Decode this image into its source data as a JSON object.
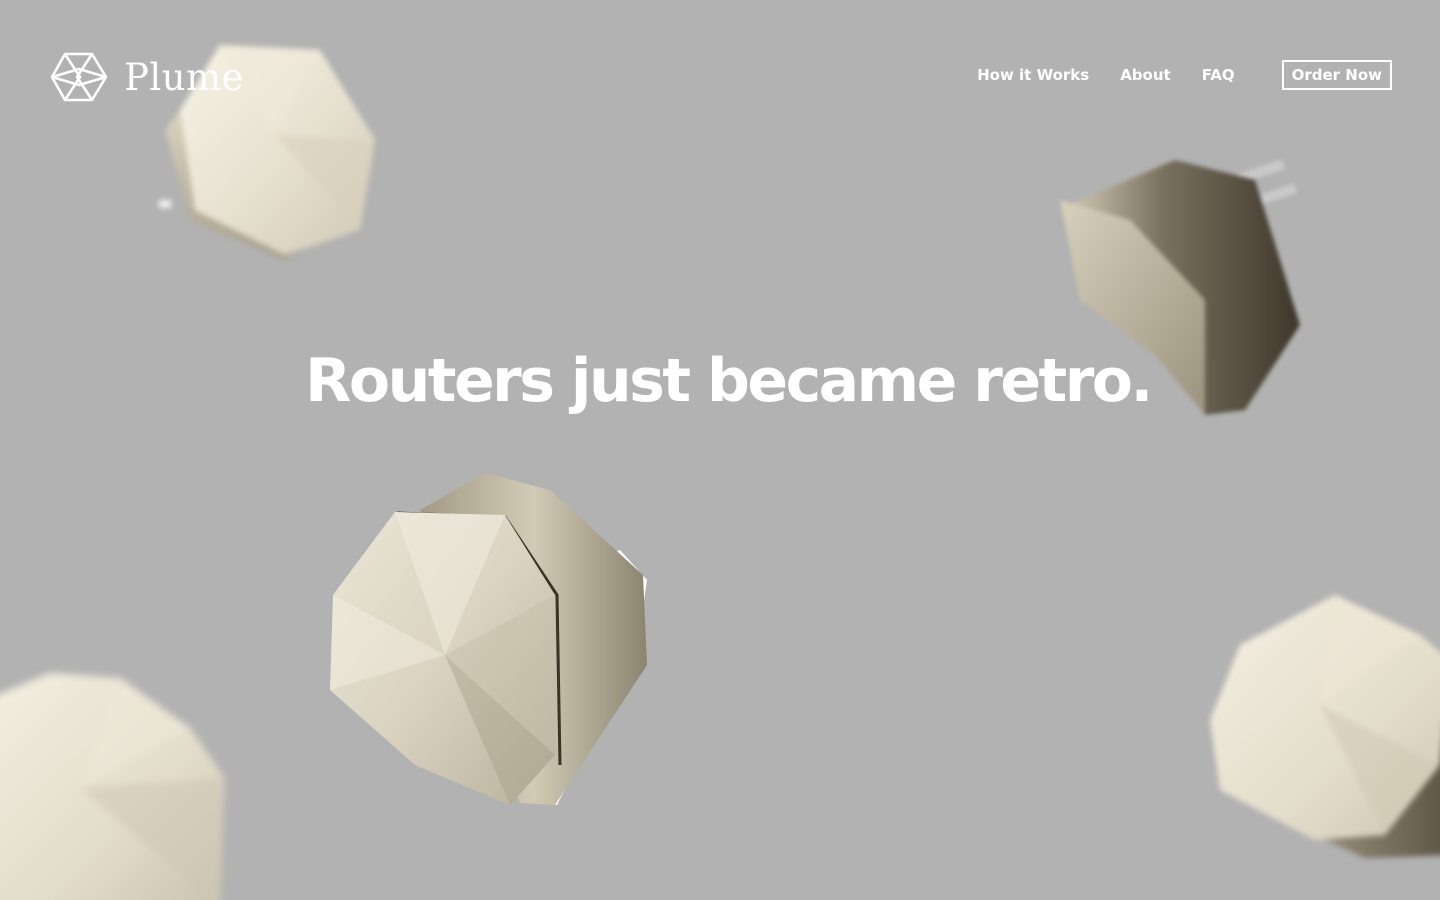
{
  "brand": {
    "name": "Plume",
    "logo_icon": "plume-hexagon-icon"
  },
  "nav": {
    "items": [
      {
        "label": "How it Works"
      },
      {
        "label": "About"
      },
      {
        "label": "FAQ"
      }
    ],
    "cta": "Order Now"
  },
  "hero": {
    "headline": "Routers just became retro."
  },
  "colors": {
    "background": "#b2b2b2",
    "text": "#ffffff",
    "pod_face": "#e8e3d3",
    "pod_metal": "#8a8270"
  }
}
